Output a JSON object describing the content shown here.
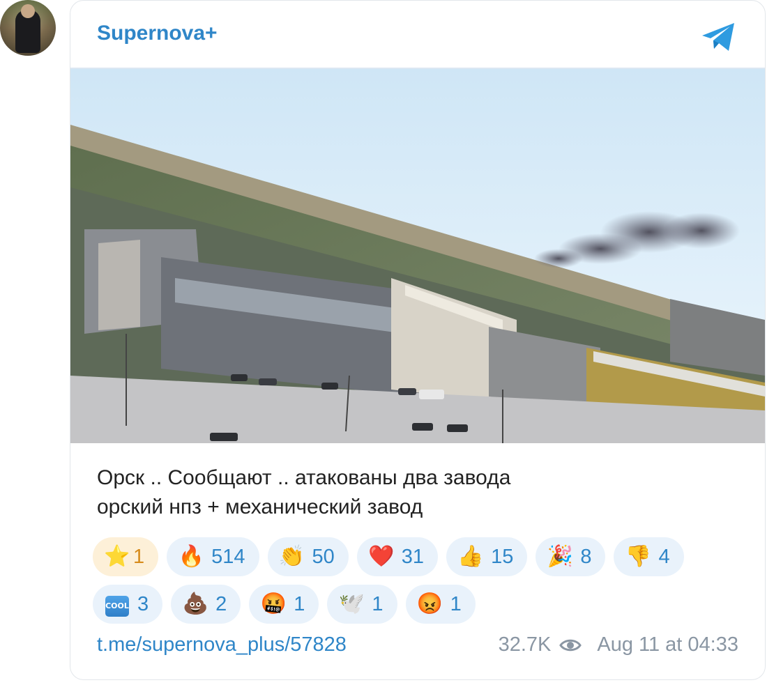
{
  "channel": {
    "name": "Supernova+"
  },
  "post": {
    "caption_lines": [
      "Орск .. Сообщают .. атакованы два завода",
      "орский нпз + механический завод"
    ],
    "reactions_row1": [
      {
        "emoji": "⭐",
        "count": "1",
        "active": true
      },
      {
        "emoji": "🔥",
        "count": "514"
      },
      {
        "emoji": "👏",
        "count": "50"
      },
      {
        "emoji": "❤️",
        "count": "31"
      },
      {
        "emoji": "👍",
        "count": "15"
      },
      {
        "emoji": "🎉",
        "count": "8"
      },
      {
        "emoji": "👎",
        "count": "4"
      }
    ],
    "reactions_row2": [
      {
        "emoji": "COOL",
        "count": "3"
      },
      {
        "emoji": "💩",
        "count": "2"
      },
      {
        "emoji": "🤬",
        "count": "1"
      },
      {
        "emoji": "🕊️",
        "count": "1"
      },
      {
        "emoji": "😡",
        "count": "1"
      }
    ],
    "link": "t.me/supernova_plus/57828",
    "views": "32.7K",
    "date": "Aug 11 at 04:33"
  },
  "icons": {
    "telegram": "telegram-icon",
    "views": "eye-icon"
  },
  "colors": {
    "accent": "#2f86c8",
    "muted": "#8a96a3",
    "reaction_bg": "#e9f2fb",
    "reaction_active_bg": "#fdf0d8"
  }
}
